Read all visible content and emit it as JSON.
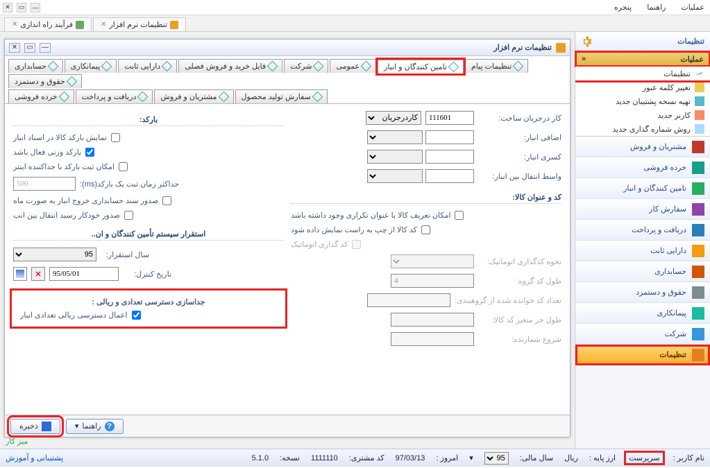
{
  "topmenu": {
    "ops": "عملیات",
    "help": "راهنما",
    "window": "پنجره"
  },
  "doc_tabs": [
    {
      "label": "فرآیند راه اندازی"
    },
    {
      "label": "تنظیمات نرم افزار"
    }
  ],
  "sidebar": {
    "title": "تنظیمات",
    "accordion": "عملیات",
    "tree": [
      {
        "label": "تنظیمات",
        "hl": true
      },
      {
        "label": "تغییر کلمه عبور"
      },
      {
        "label": "تهیه نسخه پشتیبان جدید"
      },
      {
        "label": "کاربر جدید"
      },
      {
        "label": "روش شماره گذاری جدید"
      }
    ],
    "actions": [
      {
        "label": "مشتریان و فروش",
        "color": "#c0392b"
      },
      {
        "label": "خرده فروشی",
        "color": "#16a085"
      },
      {
        "label": "تامین کنندگان و انبار",
        "color": "#27ae60"
      },
      {
        "label": "سفارش کار",
        "color": "#8e44ad"
      },
      {
        "label": "دریافت و پرداخت",
        "color": "#2980b9"
      },
      {
        "label": "دارایی ثابت",
        "color": "#f39c12"
      },
      {
        "label": "حسابداری",
        "color": "#d35400"
      },
      {
        "label": "حقوق و دستمزد",
        "color": "#7f8c8d"
      },
      {
        "label": "پیمانکاری",
        "color": "#1abc9c"
      },
      {
        "label": "شرکت",
        "color": "#3498db"
      },
      {
        "label": "تنظیمات",
        "color": "#e67e22",
        "selected": true
      }
    ]
  },
  "window": {
    "title": "تنظیمات نرم افزار",
    "tabs_row1": [
      "حسابداری",
      "پیمانکاری",
      "دارایی ثابت",
      "فایل خرید و فروش فصلی",
      "شرکت",
      "عمومی",
      "تامین کنندگان و انبار",
      "تنظیمات پیام",
      "حقوق و دستمزد"
    ],
    "tabs_row2": [
      "خرده فروشی",
      "دریافت و پرداخت",
      "مشتریان و فروش",
      "سفارش تولید محصول"
    ],
    "active_tab": "تامین کنندگان و انبار"
  },
  "form": {
    "left": {
      "barcode_title": "بارکد:",
      "chk_show_barcode": "نمایش بارکد کالا در اسناد انبار",
      "chk_weight_active": "بارکد وزنی فعال باشد",
      "chk_record_enter": "امکان ثبت بارکد با جداکننده اینتر",
      "max_time_label": "حداکثر زمان ثبت یک بارکد(ms):",
      "max_time_value": "500",
      "chk_monthly_doc": "صدور سند حسابداری خروج انبار به صورت ماه",
      "chk_auto_receipt": "صدور خودکار رسید انتقال بین انب",
      "section_deploy": "استقرار سیستم تأمین کنندگان و ان..",
      "deploy_year_label": "سال استقرار:",
      "deploy_year_value": "95",
      "control_date_label": "تاریخ کنترل:",
      "control_date_value": "95/05/01",
      "section_access": "جداسازی دسترسی تعدادی و ریالی :",
      "chk_access": "اعمال دسترسی ریالی تعدادی انبار"
    },
    "right": {
      "wip_label": "کار درجریان ساخت:",
      "wip_value": "111601",
      "wip_select": "کاردرجریان",
      "add_inv": "اضافی انبار:",
      "sub_inv": "کسری انبار:",
      "transfer_inv": "واسط انتقال بین انبار:",
      "section_code": "کد و عنوان کالا:",
      "chk_dup_title": "امکان تعریف کالا با عنوان تکراری وجود داشته باشد",
      "chk_ltr": "کد کالا از چپ به راست نمایش داده شود",
      "chk_autocode": "کد گذاری اتوماتیک",
      "autocode_method": "نحوه کدگذاری اتوماتیک:",
      "group_len": "طول کد گروه:",
      "group_len_val": "4",
      "group_read": "تعداد کد خوانده شده از گروهبندی:",
      "var_len": "طول جز متغیر کد کالا:",
      "counter_start": "شروع شمارنده:"
    }
  },
  "footer": {
    "save": "ذخیره",
    "help": "راهنما",
    "desk": "میز کار"
  },
  "status": {
    "user_label": "نام کاربر :",
    "user": "سرپرست",
    "base_curr_label": "ارز پایه :",
    "base_curr": "ریال",
    "fiscal_label": "سال مالی:",
    "fiscal": "95",
    "today_label": "امروز :",
    "today": "97/03/13",
    "cust_label": "کد مشتری:",
    "cust": "1111110",
    "ver_label": "نسخه:",
    "ver": "5.1.0",
    "support": "پشتیبانی و آموزش"
  }
}
